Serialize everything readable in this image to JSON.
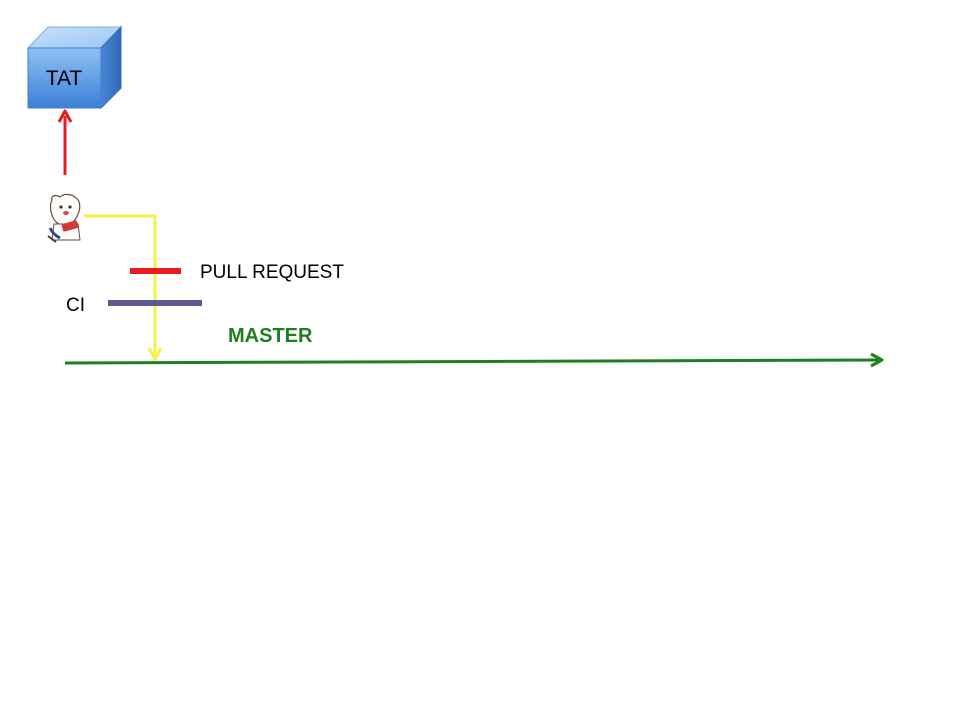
{
  "labels": {
    "tat": "TAT",
    "pull_request": "PULL REQUEST",
    "ci": "CI",
    "master": "MASTER"
  },
  "colors": {
    "master_arrow": "#1f7f1f",
    "tat_arrow": "#e81c1c",
    "branch_line": "#f4f24a",
    "pull_request_bar": "#e81c1c",
    "ci_bar": "#5b5a8e",
    "cube_front": "#4f8fe0",
    "master_text": "#1f7f1f"
  },
  "icons": {
    "tat_box": "cube-icon",
    "developer": "mascot-icon"
  }
}
